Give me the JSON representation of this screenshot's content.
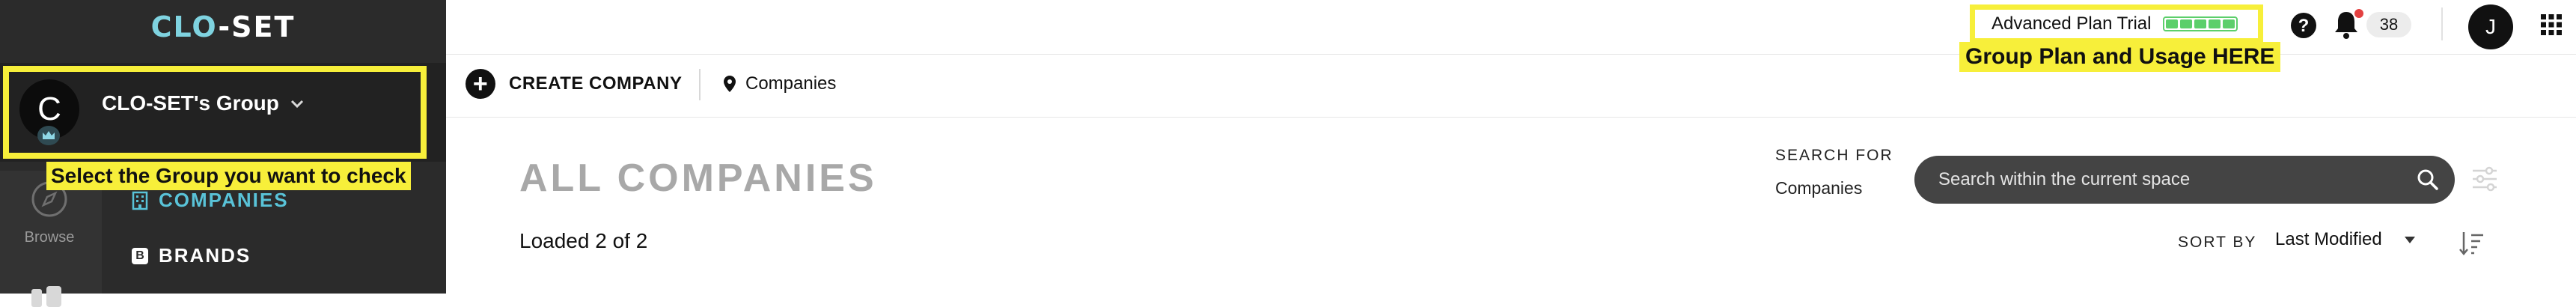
{
  "app": {
    "logo_prefix": "CLO",
    "logo_suffix": "-SET"
  },
  "sidebar": {
    "group_initial": "C",
    "group_name": "CLO-SET's Group",
    "group_annotation": "Select the Group you want to check",
    "rail": {
      "browse_label": "Browse"
    },
    "nav": [
      {
        "label": "COMPANIES",
        "icon": "building-icon",
        "active": true
      },
      {
        "label": "BRANDS",
        "icon": "b-badge-icon",
        "badge": "B",
        "active": false
      }
    ]
  },
  "header": {
    "plan_label": "Advanced Plan Trial",
    "usage_segments": 5,
    "usage_filled": 5,
    "plan_annotation": "Group Plan and Usage HERE",
    "notification_count": "38",
    "user_initial": "J"
  },
  "toolbar": {
    "create_label": "CREATE COMPANY",
    "breadcrumb": "Companies"
  },
  "content": {
    "title": "ALL COMPANIES",
    "loaded_text": "Loaded 2 of 2",
    "search_for_label": "SEARCH FOR",
    "search_scope": "Companies",
    "search_placeholder": "Search within the current space",
    "sort_label": "SORT BY",
    "sort_value": "Last Modified"
  },
  "colors": {
    "annotation_yellow": "#f7ef3a",
    "accent_teal": "#59c3d8",
    "usage_green": "#5ccf6b",
    "sidebar_dark": "#2b2b2b"
  }
}
